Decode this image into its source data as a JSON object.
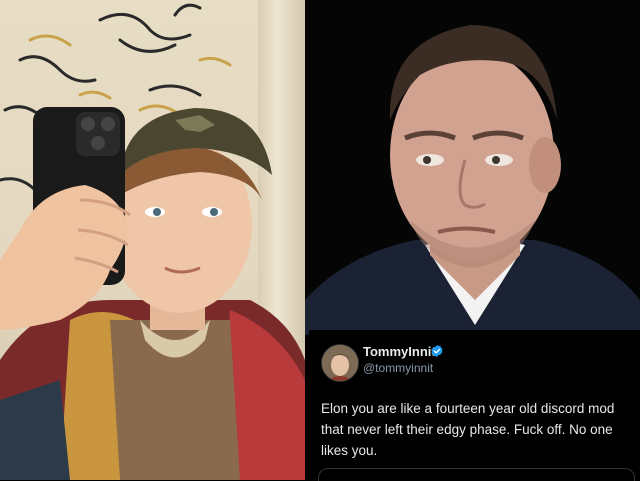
{
  "left_photo": {
    "description_icon": "selfie-photo"
  },
  "right_photo": {
    "description_icon": "portrait-photo"
  },
  "tweet": {
    "display_name": "TommyInnit",
    "handle": "@tommyinnit",
    "text": "Elon you are like a fourteen year old discord mod that never left their edgy phase. Fuck off. No one likes you.",
    "verified_icon": "verified-badge-icon",
    "verified_color": "#1d9bf0"
  },
  "colors": {
    "tweet_background": "#000000",
    "text_primary": "#e7e9ea",
    "text_secondary": "#8b98a5"
  }
}
